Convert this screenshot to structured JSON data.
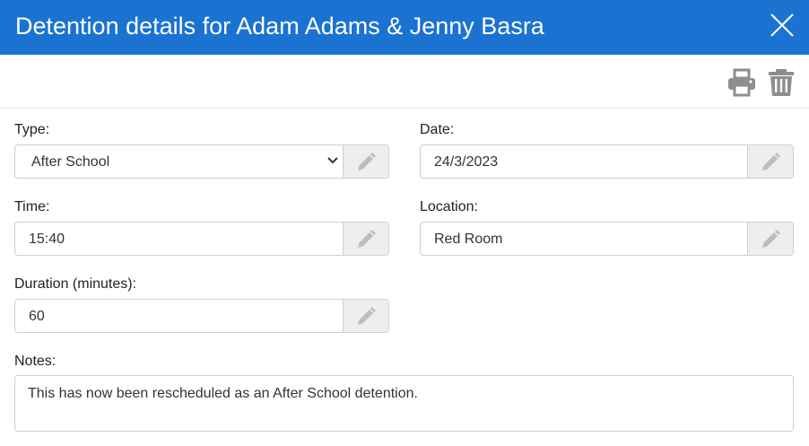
{
  "header": {
    "title": "Detention details for Adam Adams & Jenny Basra",
    "close_icon": "close-icon",
    "background_color": "#1a73d1"
  },
  "toolbar": {
    "print_icon": "print-icon",
    "delete_icon": "trash-icon"
  },
  "fields": {
    "type": {
      "label": "Type:",
      "value": "After School"
    },
    "date": {
      "label": "Date:",
      "value": "24/3/2023"
    },
    "time": {
      "label": "Time:",
      "value": "15:40"
    },
    "location": {
      "label": "Location:",
      "value": "Red Room"
    },
    "duration": {
      "label": "Duration (minutes):",
      "value": "60"
    },
    "notes": {
      "label": "Notes:",
      "value": "This has now been rescheduled as an After School detention."
    }
  },
  "edit_icon": "pencil-icon"
}
